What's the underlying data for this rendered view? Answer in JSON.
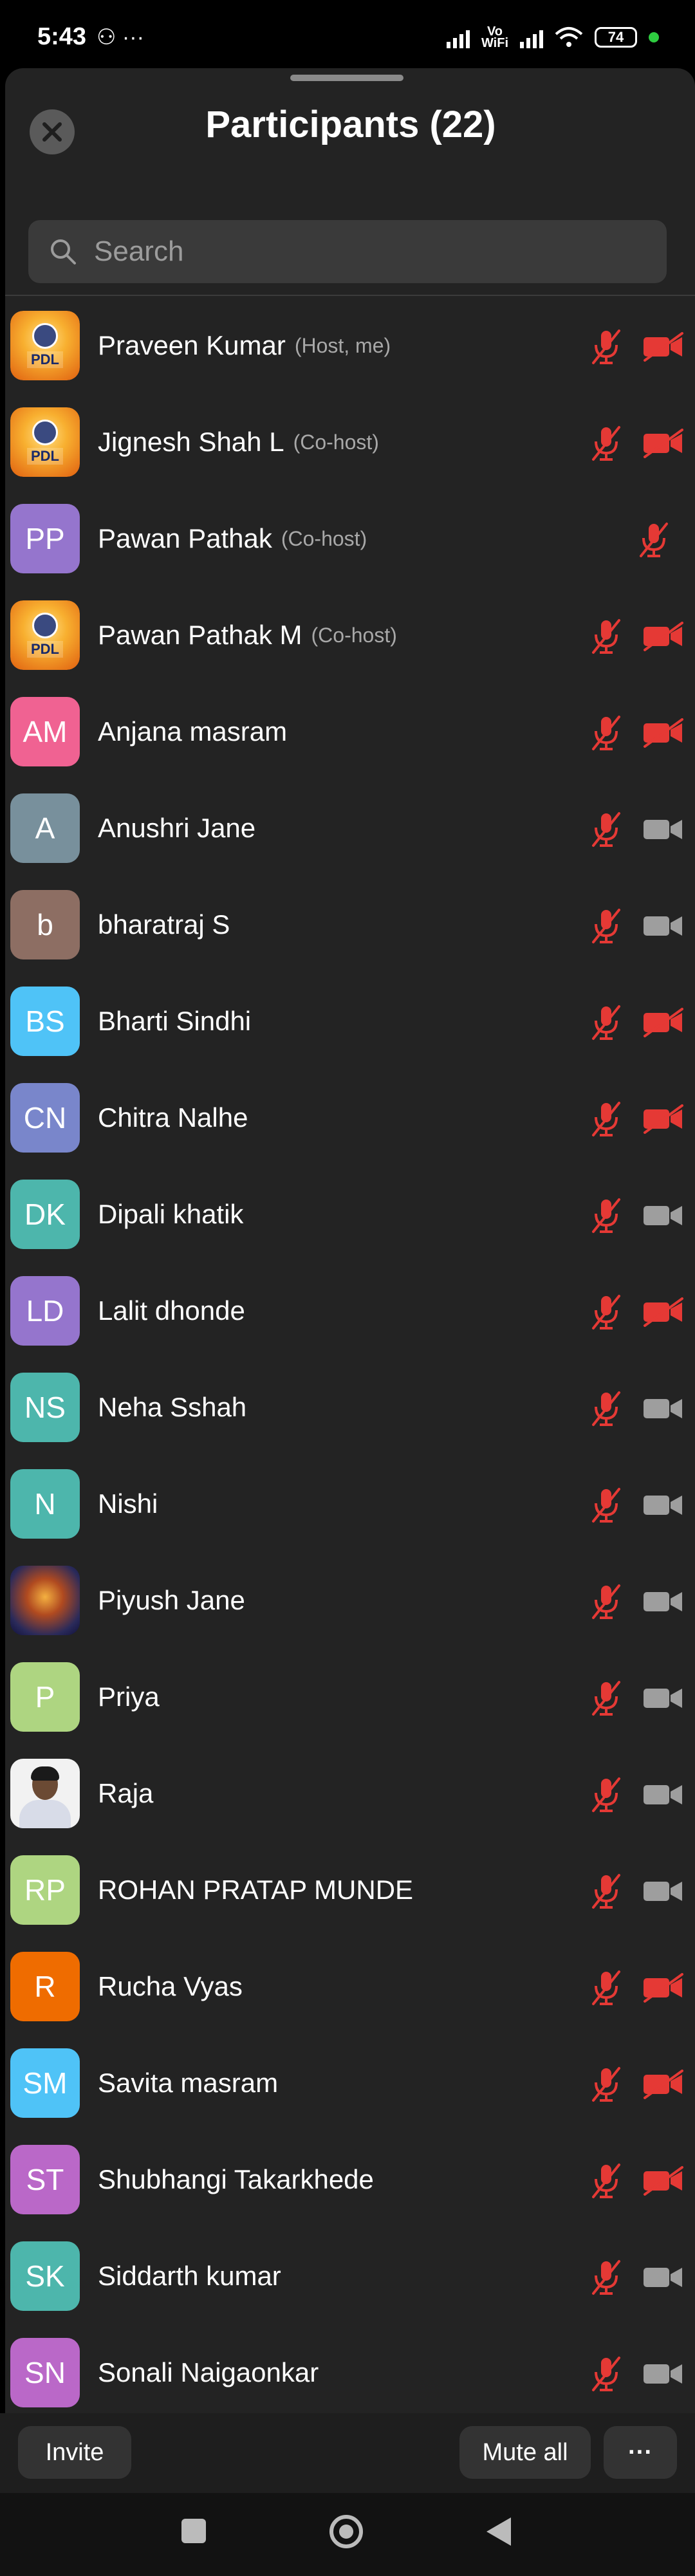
{
  "status_bar": {
    "time": "5:43",
    "left_icons": "⚇ ···",
    "vowifi": "Vo\nWiFi",
    "battery": "74"
  },
  "header": {
    "title": "Participants (22)",
    "close_icon": "close-icon"
  },
  "search": {
    "placeholder": "Search"
  },
  "participants": [
    {
      "name": "Praveen Kumar",
      "role": "(Host, me)",
      "avatar": "pdl-logo",
      "mic": "muted",
      "video": "off"
    },
    {
      "name": "Jignesh Shah L",
      "role": "(Co-host)",
      "avatar": "pdl-logo",
      "mic": "muted",
      "video": "off"
    },
    {
      "name": "Pawan Pathak",
      "role": "(Co-host)",
      "initials": "PP",
      "avatar_color": "#9575cd",
      "mic": "muted",
      "video": "none"
    },
    {
      "name": "Pawan Pathak M",
      "role": "(Co-host)",
      "avatar": "pdl-logo",
      "mic": "muted",
      "video": "off"
    },
    {
      "name": "Anjana masram",
      "initials": "AM",
      "avatar_color": "#f06292",
      "mic": "muted",
      "video": "off"
    },
    {
      "name": "Anushri Jane",
      "initials": "A",
      "avatar_color": "#78909c",
      "mic": "muted",
      "video": "available"
    },
    {
      "name": "bharatraj S",
      "initials": "b",
      "avatar_color": "#8d6e63",
      "mic": "muted",
      "video": "available"
    },
    {
      "name": "Bharti Sindhi",
      "initials": "BS",
      "avatar_color": "#4fc3f7",
      "mic": "muted",
      "video": "off"
    },
    {
      "name": "Chitra Nalhe",
      "initials": "CN",
      "avatar_color": "#7986cb",
      "mic": "muted",
      "video": "off"
    },
    {
      "name": "Dipali khatik",
      "initials": "DK",
      "avatar_color": "#4db6ac",
      "mic": "muted",
      "video": "available"
    },
    {
      "name": "Lalit dhonde",
      "initials": "LD",
      "avatar_color": "#9575cd",
      "mic": "muted",
      "video": "off"
    },
    {
      "name": "Neha Sshah",
      "initials": "NS",
      "avatar_color": "#4db6ac",
      "mic": "muted",
      "video": "available"
    },
    {
      "name": "Nishi",
      "initials": "N",
      "avatar_color": "#4db6ac",
      "mic": "muted",
      "video": "available"
    },
    {
      "name": "Piyush Jane",
      "avatar": "deity",
      "mic": "muted",
      "video": "available"
    },
    {
      "name": "Priya",
      "initials": "P",
      "avatar_color": "#aed581",
      "mic": "muted",
      "video": "available"
    },
    {
      "name": "Raja",
      "avatar": "person",
      "mic": "muted",
      "video": "available"
    },
    {
      "name": "ROHAN PRATAP MUNDE",
      "initials": "RP",
      "avatar_color": "#aed581",
      "mic": "muted",
      "video": "available"
    },
    {
      "name": "Rucha Vyas",
      "initials": "R",
      "avatar_color": "#ef6c00",
      "mic": "muted",
      "video": "off"
    },
    {
      "name": "Savita masram",
      "initials": "SM",
      "avatar_color": "#4fc3f7",
      "mic": "muted",
      "video": "off"
    },
    {
      "name": "Shubhangi Takarkhede",
      "initials": "ST",
      "avatar_color": "#ba68c8",
      "mic": "muted",
      "video": "off"
    },
    {
      "name": "Siddarth kumar",
      "initials": "SK",
      "avatar_color": "#4db6ac",
      "mic": "muted",
      "video": "available"
    },
    {
      "name": "Sonali Naigaonkar",
      "initials": "SN",
      "avatar_color": "#ba68c8",
      "mic": "muted",
      "video": "available"
    }
  ],
  "bottom_bar": {
    "invite_label": "Invite",
    "mute_all_label": "Mute all",
    "more_label": "···"
  },
  "colors": {
    "muted_red": "#e53935",
    "icon_gray": "#9e9e9e"
  }
}
